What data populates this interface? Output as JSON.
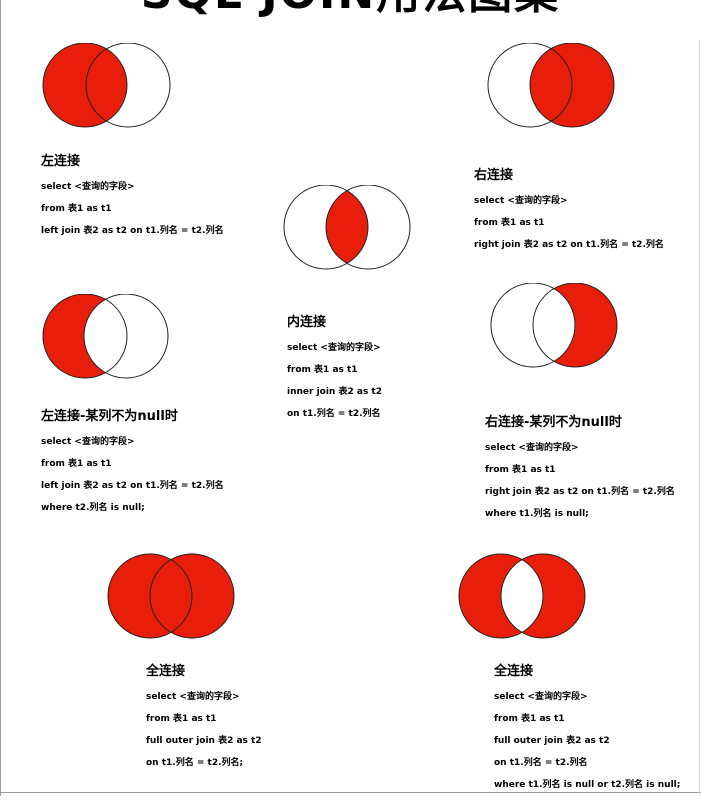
{
  "title": "SQL JOIN用法图集",
  "colors": {
    "fill": "#e81e0a",
    "stroke": "#222222",
    "background": "#ffffff"
  },
  "joins": [
    {
      "label": "左连接",
      "lines": [
        "select  <查询的字段>",
        "from  表1  as  t1",
        "left  join  表2  as  t2  on t1.列名 = t2.列名"
      ]
    },
    {
      "label": "内连接",
      "lines": [
        "select  <查询的字段>",
        "from  表1  as  t1",
        "inner join  表2  as  t2",
        "on t1.列名 = t2.列名"
      ]
    },
    {
      "label": "右连接",
      "lines": [
        "select  <查询的字段>",
        "from  表1  as  t1",
        "right  join  表2  as  t2  on t1.列名 = t2.列名"
      ]
    },
    {
      "label": "左连接-某列不为null时",
      "lines": [
        "select  <查询的字段>",
        "from  表1  as  t1",
        "left join  表2  as  t2  on t1.列名 = t2.列名",
        "where t2.列名 is null;"
      ]
    },
    {
      "label": "右连接-某列不为null时",
      "lines": [
        "select  <查询的字段>",
        "from  表1  as  t1",
        "right join  表2  as  t2  on t1.列名 = t2.列名",
        "where t1.列名 is null;"
      ]
    },
    {
      "label": "全连接",
      "lines": [
        "select  <查询的字段>",
        "from  表1  as  t1",
        "full outer join  表2  as  t2",
        "on t1.列名 = t2.列名;"
      ]
    },
    {
      "label": "全连接",
      "lines": [
        "select  <查询的字段>",
        "from  表1  as  t1",
        "full outer join  表2  as  t2",
        "on t1.列名 = t2.列名",
        "where t1.列名 is null or t2.列名 is null;"
      ]
    }
  ]
}
